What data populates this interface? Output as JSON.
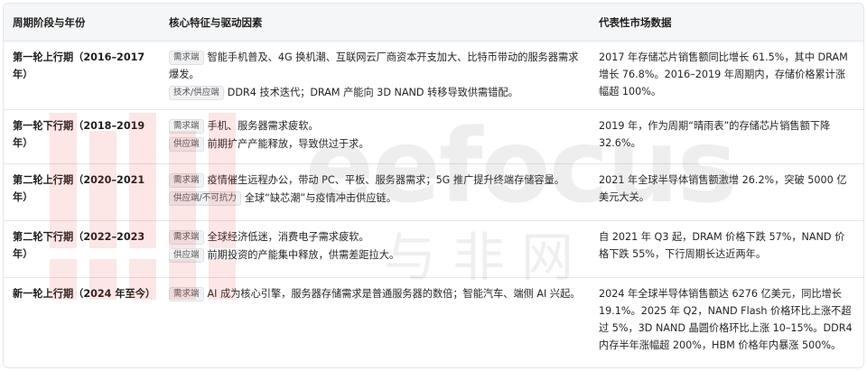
{
  "table": {
    "headers": [
      "周期阶段与年份",
      "核心特征与驱动因素",
      "代表性市场数据"
    ],
    "rows": [
      {
        "phase": "第一轮上行期（2016–2017年）",
        "drivers": [
          {
            "tag": "需求端",
            "text": "智能手机普及、4G 换机潮、互联网云厂商资本开支加大、比特币带动的服务器需求爆发。"
          },
          {
            "tag": "技术/供应端",
            "text": "DDR4 技术迭代；DRAM 产能向 3D NAND 转移导致供需错配。"
          }
        ],
        "data": "2017 年存储芯片销售额同比增长 61.5%，其中 DRAM 增长 76.8%。2016–2019 年周期内，存储价格累计涨幅超 100%。"
      },
      {
        "phase": "第一轮下行期（2018–2019年）",
        "drivers": [
          {
            "tag": "需求端",
            "text": "手机、服务器需求疲软。"
          },
          {
            "tag": "供应端",
            "text": "前期扩产产能释放，导致供过于求。"
          }
        ],
        "data": "2019 年，作为周期“晴雨表”的存储芯片销售额下降 32.6%。"
      },
      {
        "phase": "第二轮上行期（2020–2021年）",
        "drivers": [
          {
            "tag": "需求端",
            "text": "疫情催生远程办公，带动 PC、平板、服务器需求；5G 推广提升终端存储容量。"
          },
          {
            "tag": "供应端/不可抗力",
            "text": "全球“缺芯潮”与疫情冲击供应链。"
          }
        ],
        "data": "2021 年全球半导体销售额激增 26.2%，突破 5000 亿美元大关。"
      },
      {
        "phase": "第二轮下行期（2022–2023年）",
        "drivers": [
          {
            "tag": "需求端",
            "text": "全球经济低迷，消费电子需求疲软。"
          },
          {
            "tag": "供应端",
            "text": "前期投资的产能集中释放，供需差距拉大。"
          }
        ],
        "data": "自 2021 年 Q3 起，DRAM 价格下跌 57%，NAND 价格下跌 55%，下行周期长达近两年。"
      },
      {
        "phase": "新一轮上行期（2024 年至今）",
        "drivers": [
          {
            "tag": "需求端",
            "text": "AI 成为核心引擎，服务器存储需求是普通服务器的数倍；智能汽车、端侧 AI 兴起。"
          }
        ],
        "data": "2024 年全球半导体销售额达 6276 亿美元，同比增长 19.1%。2025 年 Q2，NAND Flash 价格环比上涨不超过 5%，3D NAND 晶圆价格环比上涨 10–15%。DDR4 内存半年涨幅超 200%，HBM 价格年内暴涨 500%。"
      }
    ]
  },
  "watermark": {
    "text": "eefocus",
    "subtext": "与非网",
    "color": "#e3342f"
  }
}
